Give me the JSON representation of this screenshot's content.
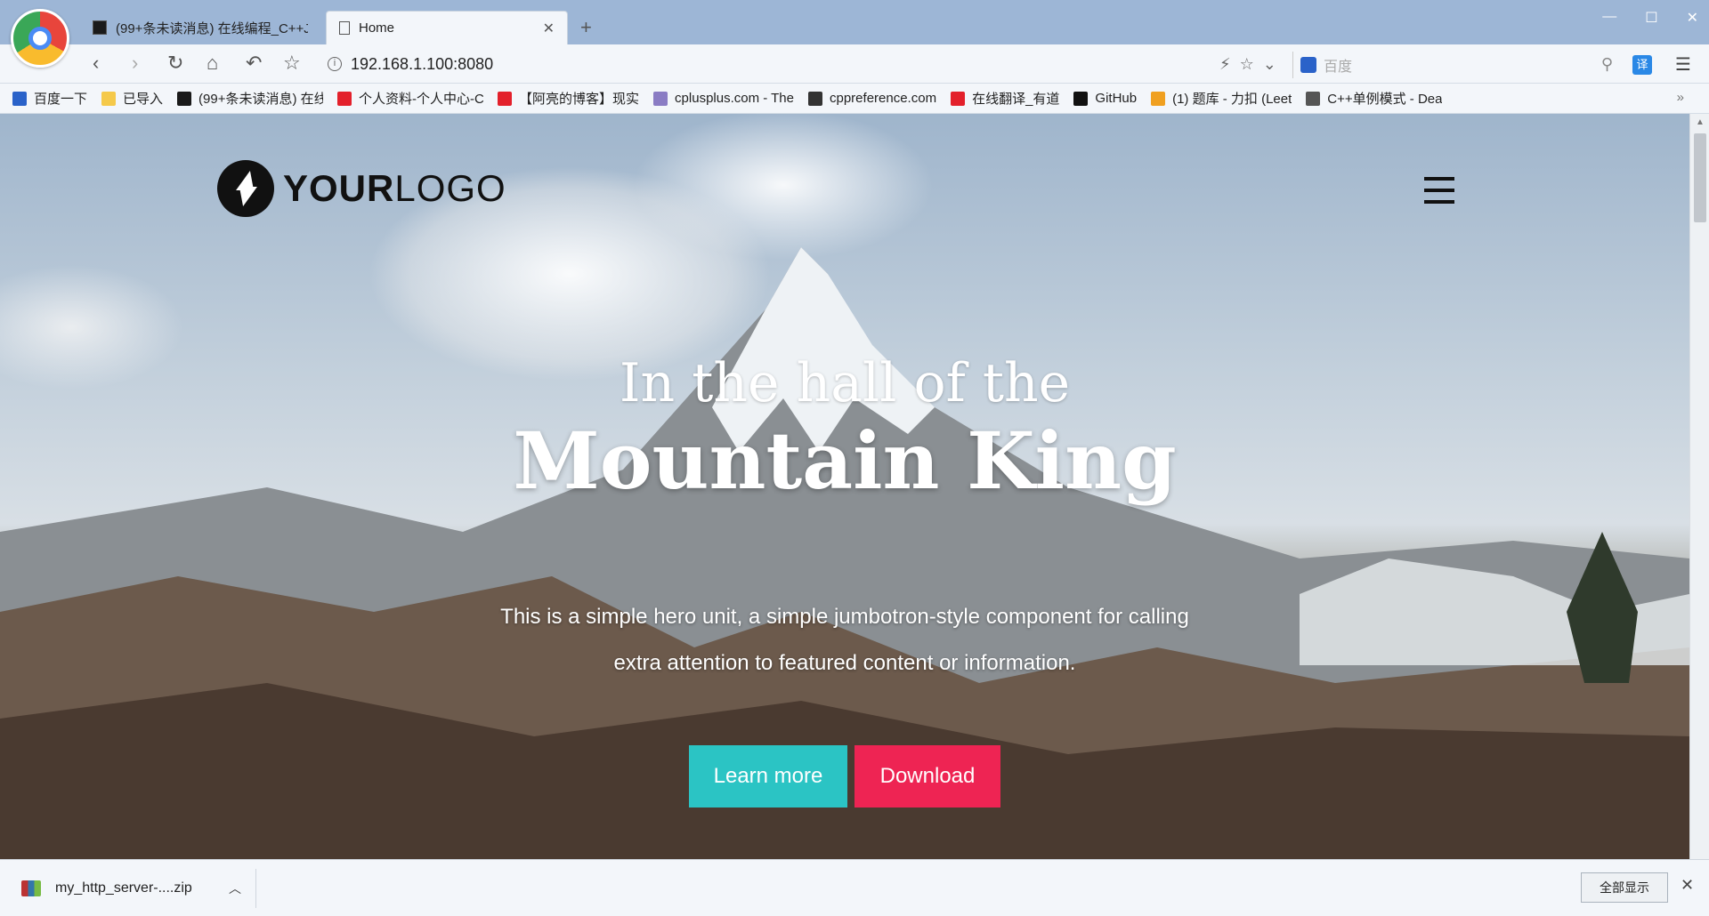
{
  "browser": {
    "tabs": [
      {
        "title": "(99+条未读消息) 在线编程_C++J",
        "active": false
      },
      {
        "title": "Home",
        "active": true
      }
    ],
    "new_tab": "+",
    "window_controls": [
      "—",
      "☐",
      "✕"
    ],
    "url": "192.168.1.100:8080",
    "search_placeholder": "百度",
    "translate_label": "译"
  },
  "bookmarks": [
    {
      "label": "百度一下",
      "icon": "baidu-paw-icon",
      "color": "#2a62c9"
    },
    {
      "label": "已导入",
      "icon": "folder-icon",
      "color": "#f5c94a"
    },
    {
      "label": "(99+条未读消息) 在线",
      "icon": "csdn-icon",
      "color": "#1a1a1a"
    },
    {
      "label": "个人资料-个人中心-C",
      "icon": "csdn-c-icon",
      "color": "#e3202b"
    },
    {
      "label": "【阿亮的博客】现实",
      "icon": "csdn-c-icon",
      "color": "#e3202b"
    },
    {
      "label": "cplusplus.com - The",
      "icon": "cplusplus-icon",
      "color": "#8a7cc4"
    },
    {
      "label": "cppreference.com",
      "icon": "cppreference-icon",
      "color": "#333333"
    },
    {
      "label": "在线翻译_有道",
      "icon": "youdao-icon",
      "color": "#e3202b"
    },
    {
      "label": "GitHub",
      "icon": "github-icon",
      "color": "#111111"
    },
    {
      "label": "(1) 题库 - 力扣 (Leet",
      "icon": "leetcode-icon",
      "color": "#f0a020"
    },
    {
      "label": "C++单例模式 - Dea",
      "icon": "blog-icon",
      "color": "#555555"
    }
  ],
  "bookmarks_more": "»",
  "hero": {
    "logo_bold": "YOUR",
    "logo_light": "LOGO",
    "subtitle": "In the hall of the",
    "title": "Mountain King",
    "description": "This is a simple hero unit, a simple jumbotron-style component for calling extra attention to featured content or information.",
    "learn_more": "Learn more",
    "download": "Download",
    "colors": {
      "learn": "#2bc4c4",
      "download": "#ee2453"
    }
  },
  "downloads": {
    "file_name": "my_http_server-....zip",
    "show_all": "全部显示"
  }
}
